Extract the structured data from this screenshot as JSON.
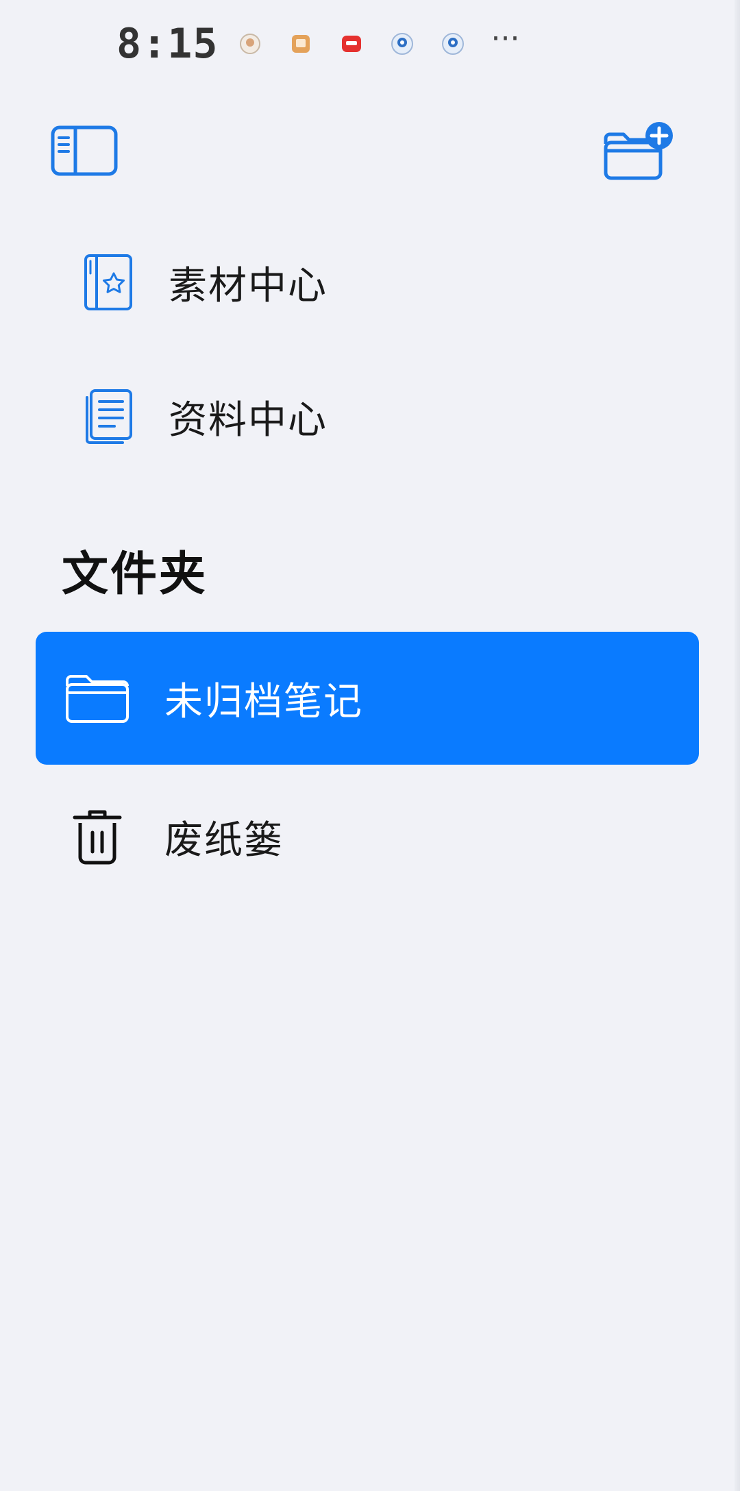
{
  "status_bar": {
    "time": "8:15",
    "more": "···",
    "notification_icons": [
      "app-notification-icon",
      "app-notification-icon",
      "app-notification-icon",
      "app-notification-icon",
      "app-notification-icon"
    ]
  },
  "toolbar": {
    "sidebar_toggle_icon": "sidebar-icon",
    "new_folder_icon": "folder-plus-icon"
  },
  "library": [
    {
      "label": "素材中心",
      "icon": "starred-book-icon"
    },
    {
      "label": "资料中心",
      "icon": "documents-icon"
    }
  ],
  "folders_section": {
    "title": "文件夹",
    "items": [
      {
        "label": "未归档笔记",
        "icon": "folder-icon",
        "selected": true
      },
      {
        "label": "废纸篓",
        "icon": "trash-icon",
        "selected": false
      }
    ]
  },
  "colors": {
    "accent": "#0a7bff",
    "background": "#f1f2f7",
    "text": "#111111"
  }
}
